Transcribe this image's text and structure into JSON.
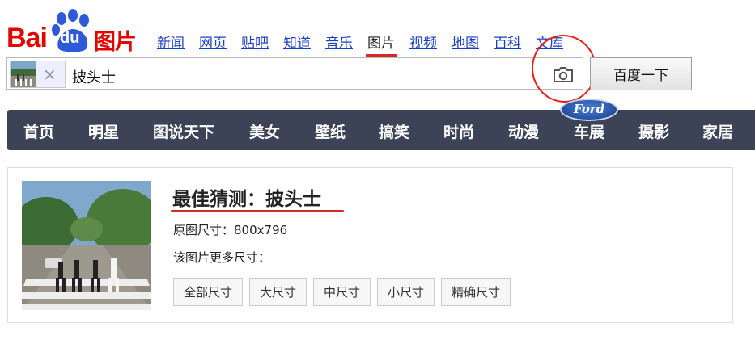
{
  "logo": {
    "bai": "Bai",
    "du": "du",
    "pic": "图片"
  },
  "topnav": [
    "新闻",
    "网页",
    "贴吧",
    "知道",
    "音乐",
    "图片",
    "视频",
    "地图",
    "百科",
    "文库"
  ],
  "search": {
    "query": "披头士",
    "clear": "×",
    "submit": "百度一下"
  },
  "categories": [
    "首页",
    "明星",
    "图说天下",
    "美女",
    "壁纸",
    "搞笑",
    "时尚",
    "动漫",
    "车展",
    "摄影",
    "家居"
  ],
  "sponsor": "Ford",
  "result": {
    "guess": "最佳猜测：披头士",
    "size_label": "原图尺寸：",
    "size_value": "800x796",
    "more_sizes": "该图片更多尺寸：",
    "size_buttons": [
      "全部尺寸",
      "大尺寸",
      "中尺寸",
      "小尺寸",
      "精确尺寸"
    ]
  }
}
